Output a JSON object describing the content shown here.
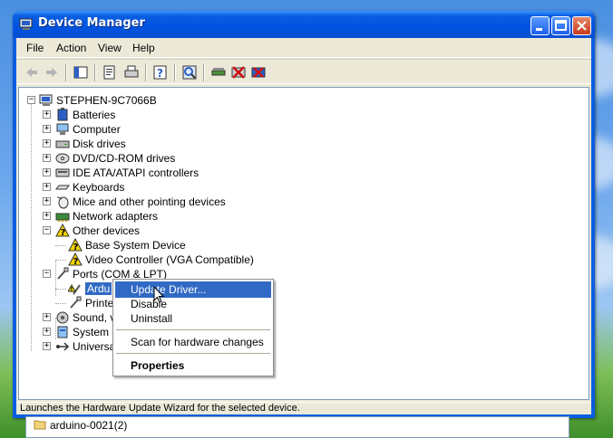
{
  "window": {
    "title": "Device Manager",
    "menu": [
      "File",
      "Action",
      "View",
      "Help"
    ],
    "status": "Launches the Hardware Update Wizard for the selected device."
  },
  "toolbar": {
    "icons": [
      "back-arrow-icon",
      "forward-arrow-icon",
      "show-hide-console-tree-icon",
      "properties-icon",
      "print-icon",
      "help-icon",
      "scan-hardware-icon",
      "update-driver-icon",
      "disable-device-icon",
      "uninstall-device-icon"
    ]
  },
  "tree": {
    "root": "STEPHEN-9C7066B",
    "categories": [
      {
        "label": "Batteries",
        "icon": "battery-icon"
      },
      {
        "label": "Computer",
        "icon": "computer-icon"
      },
      {
        "label": "Disk drives",
        "icon": "disk-drive-icon"
      },
      {
        "label": "DVD/CD-ROM drives",
        "icon": "cdrom-icon"
      },
      {
        "label": "IDE ATA/ATAPI controllers",
        "icon": "ide-controller-icon"
      },
      {
        "label": "Keyboards",
        "icon": "keyboard-icon"
      },
      {
        "label": "Mice and other pointing devices",
        "icon": "mouse-icon"
      },
      {
        "label": "Network adapters",
        "icon": "network-adapter-icon"
      },
      {
        "label": "Other devices",
        "icon": "unknown-device-icon"
      }
    ],
    "other_devices": [
      "Base System Device",
      "Video Controller (VGA Compatible)"
    ],
    "ports": "Ports (COM & LPT)",
    "ports_children": [
      "Ardu",
      "Printe"
    ],
    "after": [
      {
        "label": "Sound, v",
        "icon": "sound-icon"
      },
      {
        "label": "System c",
        "icon": "system-device-icon"
      },
      {
        "label": "Universa",
        "icon": "usb-icon"
      }
    ]
  },
  "context_menu": {
    "items": [
      "Update Driver...",
      "Disable",
      "Uninstall",
      "Scan for hardware changes",
      "Properties"
    ],
    "highlighted": "Update Driver..."
  },
  "explorer_behind": {
    "item": "arduino-0021(2)"
  }
}
